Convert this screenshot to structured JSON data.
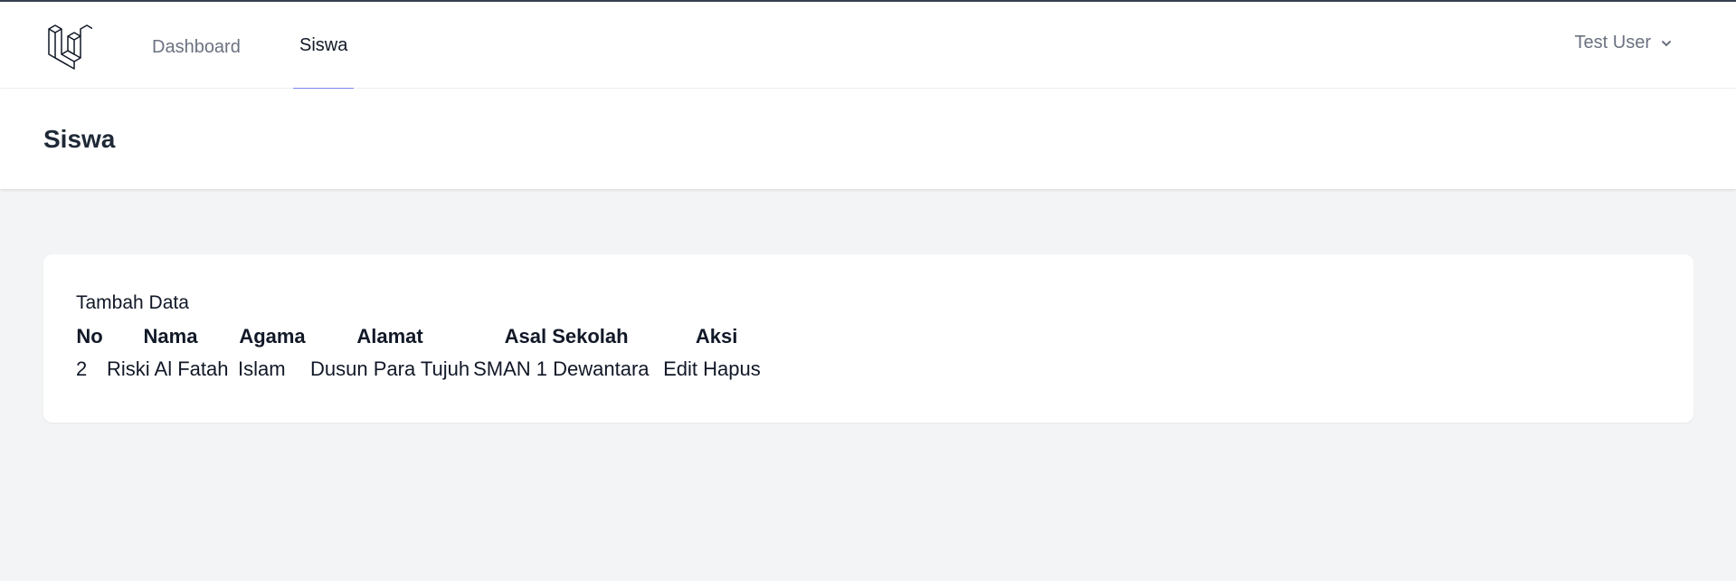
{
  "nav": {
    "links": [
      {
        "label": "Dashboard",
        "active": false
      },
      {
        "label": "Siswa",
        "active": true
      }
    ],
    "user": {
      "name": "Test User",
      "icon": "chevron-down-icon"
    },
    "logo": {
      "icon": "laravel-logo-icon"
    }
  },
  "header": {
    "title": "Siswa"
  },
  "main": {
    "add_label": "Tambah Data",
    "table": {
      "columns": [
        "No",
        "Nama",
        "Agama",
        "Alamat",
        "Asal Sekolah",
        "Aksi"
      ],
      "rows": [
        {
          "no": "2",
          "nama": "Riski Al Fatah",
          "agama": "Islam",
          "alamat": "Dusun Para Tujuh",
          "asal_sekolah": "SMAN 1 Dewantara",
          "actions": {
            "edit": "Edit",
            "hapus": "Hapus"
          }
        }
      ]
    }
  },
  "colors": {
    "active_underline": "#818cf8",
    "page_bg": "#f3f4f6"
  }
}
